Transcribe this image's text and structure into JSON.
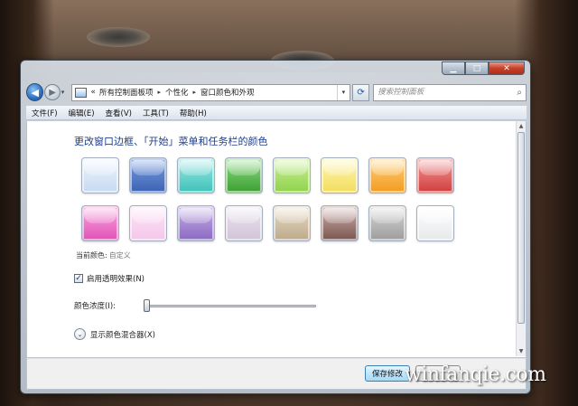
{
  "window": {
    "caption_buttons": {
      "minimize": "▁",
      "maximize": "□",
      "close": "✕"
    }
  },
  "nav": {
    "back_icon": "◀",
    "forward_icon": "▶",
    "history_dropdown": "▾",
    "address": {
      "overflow": "«",
      "segments": [
        "所有控制面板项",
        "个性化",
        "窗口颜色和外观"
      ],
      "separator": "▸",
      "dropdown": "▾"
    },
    "refresh_icon": "⟳",
    "search": {
      "placeholder": "搜索控制面板",
      "icon": "⌕"
    }
  },
  "menubar": {
    "items": [
      "文件(F)",
      "编辑(E)",
      "查看(V)",
      "工具(T)",
      "帮助(H)"
    ]
  },
  "main": {
    "title": "更改窗口边框、「开始」菜单和任务栏的颜色",
    "swatches": [
      {
        "name": "sky",
        "color_top": "#eef4fc",
        "color_bottom": "#c6daf2"
      },
      {
        "name": "twilight",
        "color_top": "#7d9ee0",
        "color_bottom": "#3a62b4"
      },
      {
        "name": "sea",
        "color_top": "#9fe8e4",
        "color_bottom": "#3ec2ba"
      },
      {
        "name": "leaf",
        "color_top": "#8edc86",
        "color_bottom": "#3c9e32"
      },
      {
        "name": "lime",
        "color_top": "#cdf09c",
        "color_bottom": "#8ed24a"
      },
      {
        "name": "lemon",
        "color_top": "#fdf6b2",
        "color_bottom": "#f4dc5e"
      },
      {
        "name": "pumpkin",
        "color_top": "#ffd27e",
        "color_bottom": "#f39a1e"
      },
      {
        "name": "ruby",
        "color_top": "#f29a9a",
        "color_bottom": "#d23c3c"
      },
      {
        "name": "fuchsia",
        "color_top": "#f8a8e0",
        "color_bottom": "#e250b6"
      },
      {
        "name": "blush",
        "color_top": "#fde6f8",
        "color_bottom": "#f4c6ea"
      },
      {
        "name": "violet",
        "color_top": "#c6b2e6",
        "color_bottom": "#8a68c2"
      },
      {
        "name": "lavender",
        "color_top": "#ece4f0",
        "color_bottom": "#d0c4d8"
      },
      {
        "name": "taupe",
        "color_top": "#e8dcc6",
        "color_bottom": "#bca98a"
      },
      {
        "name": "chocolate",
        "color_top": "#cfb4b0",
        "color_bottom": "#7a544e"
      },
      {
        "name": "slate",
        "color_top": "#d8d8d8",
        "color_bottom": "#9c9c9c"
      },
      {
        "name": "frost",
        "color_top": "#ffffff",
        "color_bottom": "#e6e8ea"
      }
    ],
    "current_color": {
      "label": "当前颜色:",
      "value": "自定义"
    },
    "transparency": {
      "checked": true,
      "check_mark": "✓",
      "label": "启用透明效果(N)"
    },
    "intensity": {
      "label": "颜色浓度(I):",
      "value_fraction": 0.0
    },
    "mixer": {
      "icon": "⌄",
      "label": "显示颜色混合器(X)"
    },
    "scrollbar": {
      "up": "▲",
      "down": "▼"
    }
  },
  "footer": {
    "save_label": "保存修改"
  },
  "watermark": "winfanqie.com"
}
